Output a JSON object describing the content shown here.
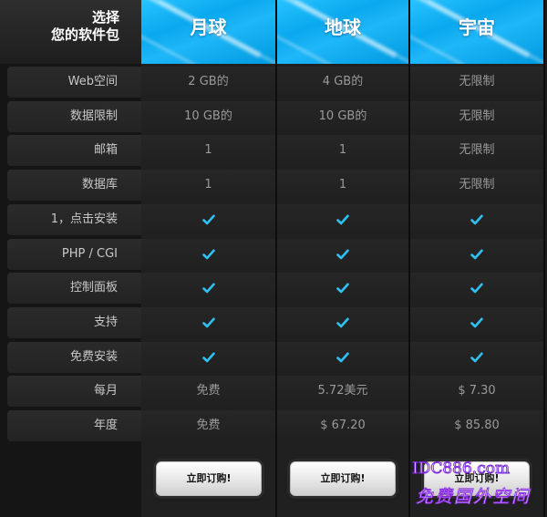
{
  "header": {
    "corner_line1": "选择",
    "corner_line2": "您的软件包"
  },
  "plans": [
    {
      "name": "月球",
      "order_label": "立即订购!"
    },
    {
      "name": "地球",
      "order_label": "立即订购!"
    },
    {
      "name": "宇宙",
      "order_label": "立即订购!"
    }
  ],
  "rows": [
    {
      "label": "Web空间",
      "values": [
        "2 GB的",
        "4 GB的",
        "无限制"
      ]
    },
    {
      "label": "数据限制",
      "values": [
        "10 GB的",
        "10 GB的",
        "无限制"
      ]
    },
    {
      "label": "邮箱",
      "values": [
        "1",
        "1",
        "无限制"
      ]
    },
    {
      "label": "数据库",
      "values": [
        "1",
        "1",
        "无限制"
      ]
    },
    {
      "label": "1，点击安装",
      "values": [
        "check",
        "check",
        "check"
      ]
    },
    {
      "label": "PHP / CGI",
      "values": [
        "check",
        "check",
        "check"
      ]
    },
    {
      "label": "控制面板",
      "values": [
        "check",
        "check",
        "check"
      ]
    },
    {
      "label": "支持",
      "values": [
        "check",
        "check",
        "check"
      ]
    },
    {
      "label": "免费安装",
      "values": [
        "check",
        "check",
        "check"
      ]
    },
    {
      "label": "每月",
      "values": [
        "免费",
        "5.72美元",
        "$ 7.30"
      ]
    },
    {
      "label": "年度",
      "values": [
        "免费",
        "$ 67.20",
        "$ 85.80"
      ]
    }
  ],
  "watermark": {
    "line1": "IDC886.com",
    "line2": "免费国外空间"
  },
  "colors": {
    "check": "#2fc0f2",
    "header_blue": "#12b0f5"
  },
  "icons": {
    "check": "checkmark-icon"
  }
}
